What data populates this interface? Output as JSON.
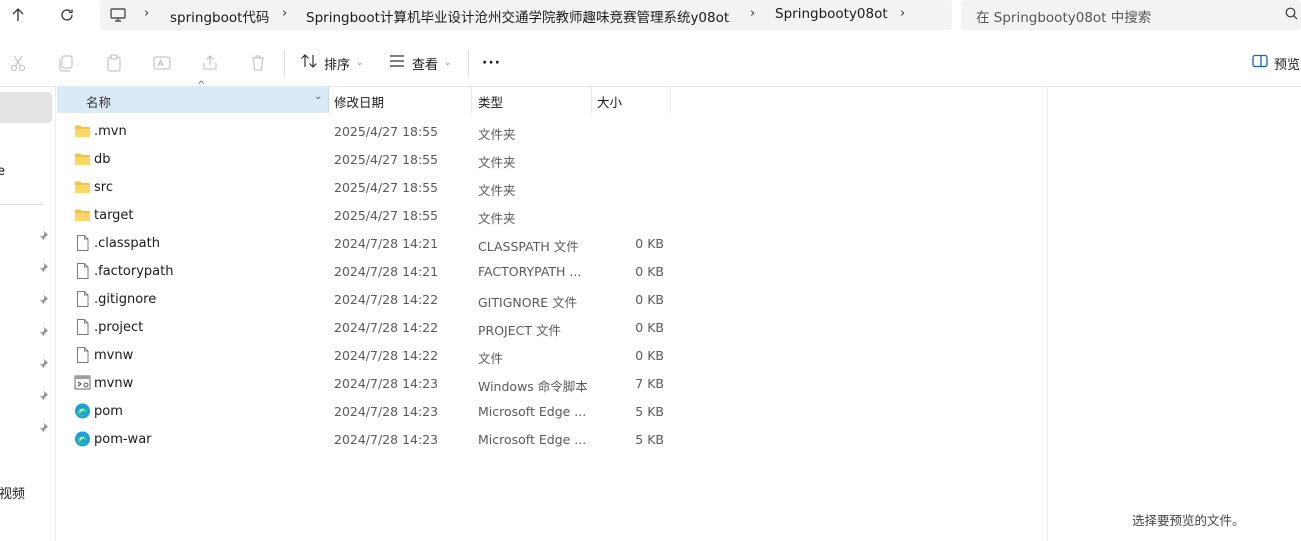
{
  "breadcrumbs": [
    "springboot代码",
    "Springboot计算机毕业设计沧州交通学院教师趣味竞赛管理系统y08ot",
    "Springbooty08ot"
  ],
  "search": {
    "placeholder": "在 Springbooty08ot 中搜索"
  },
  "toolbar": {
    "sort_label": "排序",
    "view_label": "查看",
    "more_label": "···",
    "preview_label": "预览"
  },
  "sidebar": {
    "item_e": "e",
    "item_video": "视频"
  },
  "columns": {
    "name": "名称",
    "date": "修改日期",
    "type": "类型",
    "size": "大小"
  },
  "files": [
    {
      "name": ".mvn",
      "date": "2025/4/27 18:55",
      "type": "文件夹",
      "size": "",
      "icon": "folder-icon"
    },
    {
      "name": "db",
      "date": "2025/4/27 18:55",
      "type": "文件夹",
      "size": "",
      "icon": "folder-icon"
    },
    {
      "name": "src",
      "date": "2025/4/27 18:55",
      "type": "文件夹",
      "size": "",
      "icon": "folder-icon"
    },
    {
      "name": "target",
      "date": "2025/4/27 18:55",
      "type": "文件夹",
      "size": "",
      "icon": "folder-icon"
    },
    {
      "name": ".classpath",
      "date": "2024/7/28 14:21",
      "type": "CLASSPATH 文件",
      "size": "0 KB",
      "icon": "file-icon"
    },
    {
      "name": ".factorypath",
      "date": "2024/7/28 14:21",
      "type": "FACTORYPATH ...",
      "size": "0 KB",
      "icon": "file-icon"
    },
    {
      "name": ".gitignore",
      "date": "2024/7/28 14:22",
      "type": "GITIGNORE 文件",
      "size": "0 KB",
      "icon": "file-icon"
    },
    {
      "name": ".project",
      "date": "2024/7/28 14:22",
      "type": "PROJECT 文件",
      "size": "0 KB",
      "icon": "file-icon"
    },
    {
      "name": "mvnw",
      "date": "2024/7/28 14:22",
      "type": "文件",
      "size": "0 KB",
      "icon": "file-icon"
    },
    {
      "name": "mvnw",
      "date": "2024/7/28 14:23",
      "type": "Windows 命令脚本",
      "size": "7 KB",
      "icon": "script-icon"
    },
    {
      "name": "pom",
      "date": "2024/7/28 14:23",
      "type": "Microsoft Edge ...",
      "size": "5 KB",
      "icon": "edge-icon"
    },
    {
      "name": "pom-war",
      "date": "2024/7/28 14:23",
      "type": "Microsoft Edge ...",
      "size": "5 KB",
      "icon": "edge-icon"
    }
  ],
  "preview": {
    "message": "选择要预览的文件。"
  },
  "colors": {
    "header_selected": "#dbeaf7",
    "folder": "#f5c242",
    "edge": "#1b9de2"
  }
}
